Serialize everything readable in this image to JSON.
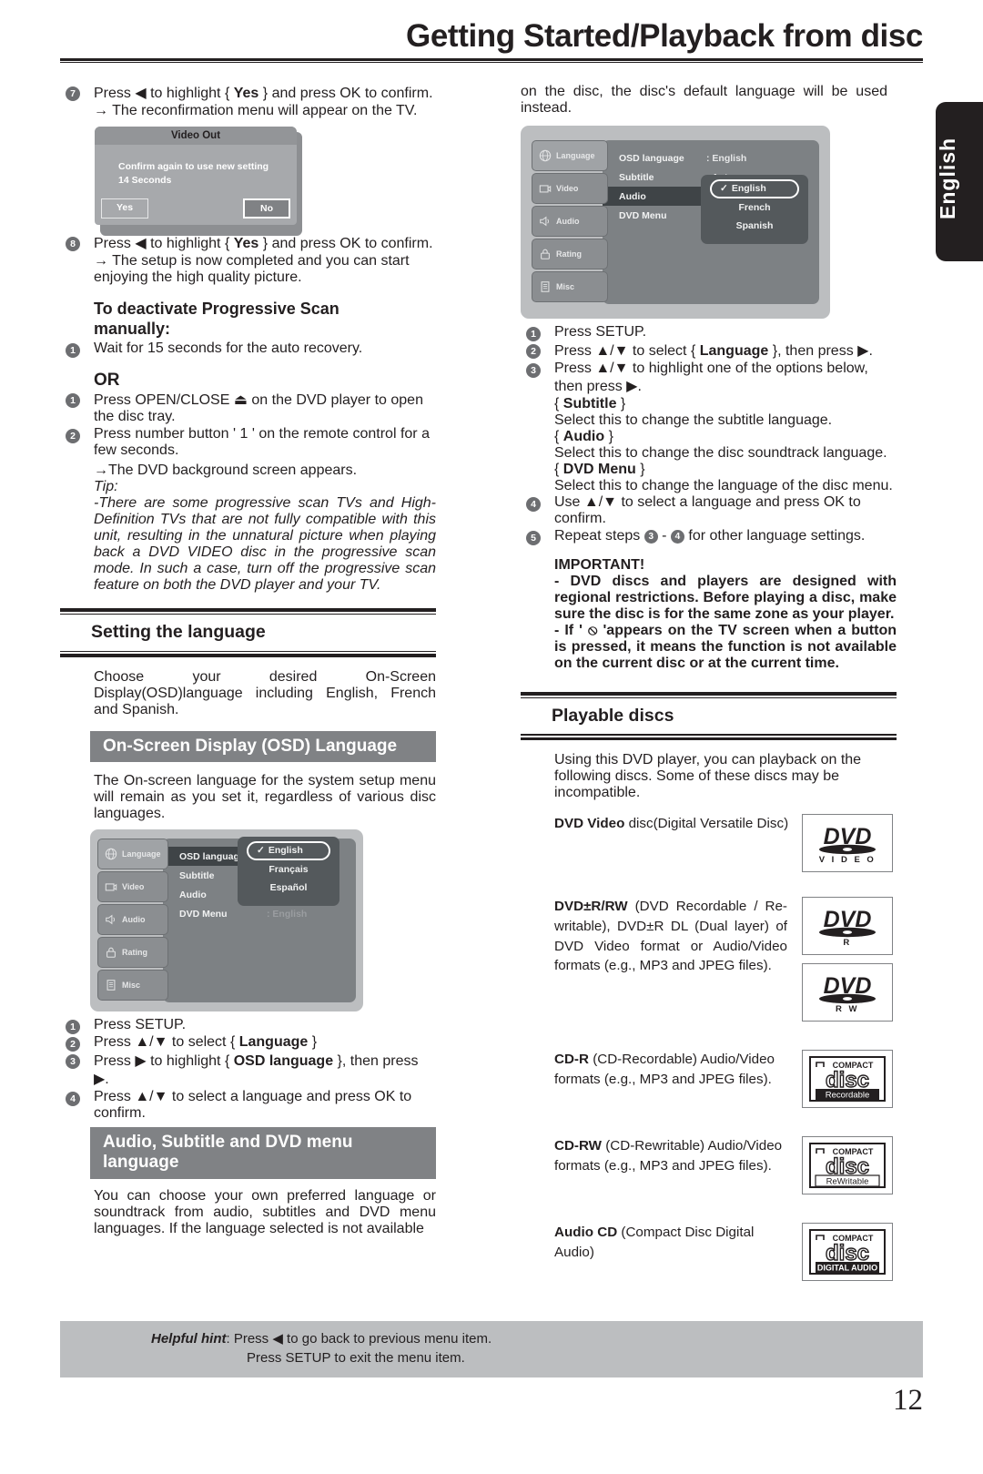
{
  "header": {
    "title": "Getting Started/Playback from disc"
  },
  "lang_tab": {
    "label": "English"
  },
  "page_number": "12",
  "left": {
    "step7": {
      "num": "7",
      "text_a": "Press ",
      "glyph": "◀",
      "text_b": " to highlight { ",
      "bold": "Yes",
      "text_c": " } and press OK to confirm.",
      "sub": "→ The reconfirmation menu will appear on the TV."
    },
    "video_out": {
      "title": "Video Out",
      "message_line1": "Confirm again to use new setting",
      "message_line2": "14 Seconds",
      "yes_label": "Yes",
      "no_label": "No"
    },
    "step8": {
      "num": "8",
      "text_a": "Press ",
      "glyph": "◀",
      "text_b": " to highlight { ",
      "bold": "Yes",
      "text_c": " } and press OK to confirm.",
      "sub": "→ The setup is now completed and you can start enjoying the high quality picture."
    },
    "deactivate_heading_l1": "To deactivate Progressive Scan",
    "deactivate_heading_l2": "manually:",
    "deactivate_step1": {
      "num": "1",
      "text": "Wait for 15 seconds for the auto recovery."
    },
    "or_label": "OR",
    "or_step1": {
      "num": "1",
      "text_a": "Press OPEN/CLOSE ",
      "glyph": "⏏",
      "text_b": " on the DVD player to open the disc tray."
    },
    "or_step2": {
      "num": "2",
      "text": "Press number button ' 1 ' on the remote  control for a few seconds."
    },
    "or_result": "→The DVD background screen appears.",
    "tip_label": "Tip:",
    "tip_text": "-There are some progressive scan TVs and High-Definition TVs that are not fully compatible with this unit, resulting in the unnatural picture when playing back a DVD VIDEO disc in the progressive scan mode. In such a case, turn off the progressive scan feature on both the DVD player and your TV.",
    "section_setting_language": "Setting the language",
    "setting_intro": "Choose your desired On-Screen Display(OSD)language including English, French and Spanish.",
    "osd_heading": "On-Screen Display (OSD) Language",
    "osd_intro": "The On-screen language for the system setup menu will remain as you set it, regardless of various disc languages.",
    "osd_menu": {
      "sidebar": [
        "Language",
        "Video",
        "Audio",
        "Rating",
        "Misc"
      ],
      "rows": [
        {
          "label": "OSD language",
          "value": ""
        },
        {
          "label": "Subtitle",
          "value": ""
        },
        {
          "label": "Audio",
          "value": ""
        },
        {
          "label": "DVD Menu",
          "value": ""
        }
      ],
      "ghost_value": ": English",
      "popup_options": [
        "English",
        "Français",
        "Español"
      ],
      "popup_selected": "English",
      "check_glyph": "✓"
    },
    "steps": [
      {
        "num": "1",
        "text": "Press SETUP."
      },
      {
        "num": "2",
        "pre": "Press ",
        "updown": "▲/▼",
        "mid": " to select { ",
        "bold": "Language",
        "post": " }"
      },
      {
        "num": "3",
        "pre": "Press ",
        "updown": "▶",
        "mid": " to highlight { ",
        "bold": "OSD language",
        "post": " }, then press ▶."
      },
      {
        "num": "4",
        "pre": "Press ",
        "updown": "▲/▼",
        "mid": " to select a language and press OK to confirm.",
        "bold": "",
        "post": ""
      }
    ],
    "audio_sub_heading_l1": "Audio, Subtitle and DVD menu",
    "audio_sub_heading_l2": "language",
    "audio_sub_text": "You can choose your own preferred language or soundtrack from audio, subtitles and DVD menu languages. If the language selected is not available"
  },
  "right": {
    "continued_text": "on the disc, the disc's default language will be used instead.",
    "osd_menu": {
      "sidebar": [
        "Language",
        "Video",
        "Audio",
        "Rating",
        "Misc"
      ],
      "rows": [
        {
          "label": "OSD language",
          "value": ": English"
        },
        {
          "label": "Subtitle",
          "value": ": Auto"
        },
        {
          "label": "Audio",
          "value": ""
        },
        {
          "label": "DVD Menu",
          "value": ""
        }
      ],
      "highlight_row": "Audio",
      "popup_options": [
        "English",
        "French",
        "Spanish"
      ],
      "popup_selected": "English",
      "check_glyph": "✓"
    },
    "steps": [
      {
        "num": "1",
        "text": "Press SETUP."
      },
      {
        "num": "2",
        "pre": "Press ",
        "updown": "▲/▼",
        "mid": " to select { ",
        "bold": "Language",
        "post": " }, then press ▶."
      },
      {
        "num": "3",
        "pre": "Press ",
        "updown": "▲/▼",
        "mid": " to highlight one of the options below, then press ▶.",
        "bold": "",
        "post": ""
      }
    ],
    "options": [
      {
        "name": "{ Subtitle }",
        "bold": "Subtitle",
        "desc": "Select this to change the subtitle language."
      },
      {
        "name": "{ Audio }",
        "bold": "Audio",
        "desc": "Select this to change the disc soundtrack language."
      },
      {
        "name": "{ DVD Menu }",
        "bold": "DVD Menu",
        "desc": "Select this to change the language of the disc menu."
      }
    ],
    "step4": {
      "num": "4",
      "text": "Use ▲/▼ to select a language and press OK to confirm."
    },
    "step5": {
      "num": "5",
      "pre": "Repeat steps ",
      "a": "3",
      "mid": " - ",
      "b": "4",
      "post": " for other language settings."
    },
    "important_label": "IMPORTANT!",
    "important_1": "- DVD discs and players are designed with regional restrictions.  Before playing a disc, make sure the disc is for the same zone as your player.",
    "important_2_pre": "- If ' ",
    "important_2_glyph": "⦸",
    "important_2_post": " 'appears on the TV screen when a button is pressed, it means the function is not available on the current disc or at the current time.",
    "section_playable": "Playable discs",
    "playable_intro": "Using this DVD player, you can playback on the following discs. Some of these discs may be incompatible.",
    "discs": [
      {
        "bold": "DVD Video",
        "rest": " disc(Digital Versatile Disc)",
        "logos": [
          {
            "kind": "dvd",
            "sub": "V I D E O"
          }
        ]
      },
      {
        "bold": "DVD±R/RW",
        "rest": " (DVD Recordable / Re-writable), DVD±R DL (Dual layer) of DVD Video format or Audio/Video formats (e.g., MP3 and JPEG files).",
        "logos": [
          {
            "kind": "dvd",
            "sub": "R"
          },
          {
            "kind": "dvd",
            "sub": "R W"
          }
        ]
      },
      {
        "bold": "CD-R",
        "rest": " (CD-Recordable) Audio/Video formats (e.g., MP3 and JPEG files).",
        "logos": [
          {
            "kind": "cd",
            "top": "COMPACT",
            "sub": "Recordable",
            "invert": true
          }
        ]
      },
      {
        "bold": "CD-RW",
        "rest": " (CD-Rewritable) Audio/Video formats (e.g., MP3 and JPEG files).",
        "logos": [
          {
            "kind": "cd",
            "top": "COMPACT",
            "sub": "ReWritable",
            "invert": false
          }
        ]
      },
      {
        "bold": "Audio CD",
        "rest": " (Compact Disc Digital Audio)",
        "logos": [
          {
            "kind": "cd",
            "top": "COMPACT",
            "sub": "DIGITAL AUDIO",
            "invert": true
          }
        ]
      }
    ]
  },
  "hint": {
    "label": "Helpful hint",
    "line1": ":  Press ◀ to go back to previous menu item.",
    "line2": "Press SETUP to exit the menu item."
  }
}
